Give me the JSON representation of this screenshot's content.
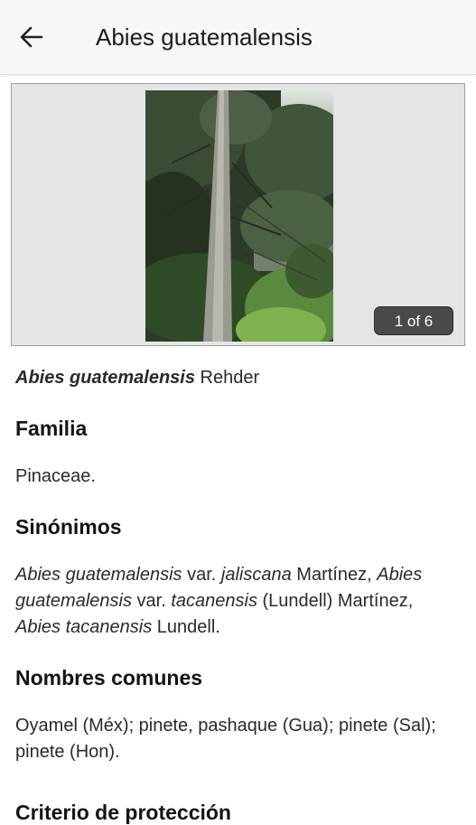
{
  "appbar": {
    "title": "Abies guatemalensis",
    "back_icon": "arrow-back-icon"
  },
  "gallery": {
    "counter": "1 of 6",
    "photo_description": "tree-photo"
  },
  "species": {
    "name_italic": "Abies guatemalensis",
    "author": " Rehder"
  },
  "familia": {
    "heading": "Familia",
    "value": "Pinaceae."
  },
  "sinonimos": {
    "heading": "Sinónimos",
    "parts": [
      {
        "text": "Abies guatemalensis",
        "italic": true
      },
      {
        "text": " var. ",
        "italic": false
      },
      {
        "text": "jaliscana",
        "italic": true
      },
      {
        "text": " Martínez, ",
        "italic": false
      },
      {
        "text": "Abies guatemalensis",
        "italic": true
      },
      {
        "text": " var. ",
        "italic": false
      },
      {
        "text": "tacanensis",
        "italic": true
      },
      {
        "text": " (Lundell) Martínez, ",
        "italic": false
      },
      {
        "text": "Abies tacanensis",
        "italic": true
      },
      {
        "text": " Lundell.",
        "italic": false
      }
    ]
  },
  "nombres": {
    "heading": "Nombres comunes",
    "value": "Oyamel (Méx); pinete, pashaque (Gua); pinete (Sal); pinete (Hon)."
  },
  "next_heading_partial": "Criterio de protección"
}
